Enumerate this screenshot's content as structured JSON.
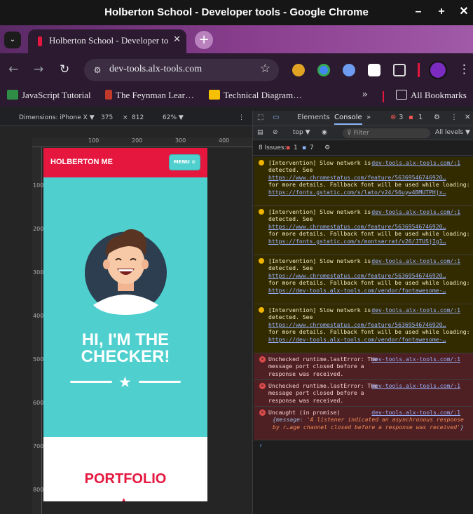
{
  "window": {
    "title": "Holberton School - Developer tools - Google Chrome",
    "controls": [
      "–",
      "+",
      "✕"
    ]
  },
  "tab": {
    "label": "Holberton School - Developer tools",
    "close": "✕",
    "new_tab": "+",
    "dropdown": "⌄"
  },
  "toolbar": {
    "back": "←",
    "forward": "→",
    "reload": "↻",
    "url": "dev-tools.alx-tools.com",
    "star": "☆",
    "menu": "⋮"
  },
  "extensions": [
    {
      "color": "#e0a324"
    },
    {
      "color": "#4285f4"
    },
    {
      "color": "#6d9cf0"
    },
    {
      "color": "#ffffff"
    },
    {
      "color": "#cccccc"
    },
    {
      "color": "#7b2bbf"
    }
  ],
  "bookmarks": [
    {
      "label": "JavaScript Tutorial",
      "color": "#2f8d46"
    },
    {
      "label": "The Feynman Lear…",
      "color": "#c0392b"
    },
    {
      "label": "Technical Diagram…",
      "color": "#f6c000"
    },
    {
      "label": "»",
      "color": "#00000000"
    },
    {
      "label": "All Bookmarks",
      "color": "#00000000"
    }
  ],
  "devbar": {
    "dimensions": "Dimensions: iPhone X ▼",
    "width": "375",
    "x": "×",
    "height": "812",
    "zoom": "62% ▼",
    "more": "⋮"
  },
  "ruler": {
    "h": [
      "100",
      "200",
      "300",
      "400"
    ],
    "v": [
      "100",
      "200",
      "300",
      "400",
      "500",
      "600",
      "700",
      "800"
    ]
  },
  "site": {
    "brand": "HOLBERTON ME",
    "menu": "MENU ≡",
    "hero_title": "HI, I'M THE CHECKER!",
    "section": "PORTFOLIO",
    "colors": {
      "accent": "#e5173f",
      "teal": "#4fd0cf"
    }
  },
  "devtools": {
    "tabs": {
      "elements": "Elements",
      "console": "Console",
      "more": "»",
      "errors": "3",
      "warnings": "1",
      "settings": "⚙",
      "menu": "⋮",
      "close": "✕"
    },
    "console_toolbar": {
      "context": "top ▼",
      "filter": "Filter",
      "levels": "All levels ▼"
    },
    "issues": {
      "label": "8 Issues:",
      "errors": "1",
      "info": "7",
      "settings": "⚙"
    },
    "messages": [
      {
        "type": "warn",
        "source": "dev-tools.alx-tools.com/:1",
        "text": "[Intervention] Slow network is detected. See",
        "link": "https://www.chromestatus.com/feature/56369546746920…",
        "text2": "for more details. Fallback font will be used while loading:",
        "link2": "https://fonts.gstatic.com/s/lato/v24/S6uyw4BMUTPHjx…"
      },
      {
        "type": "warn",
        "source": "dev-tools.alx-tools.com/:1",
        "text": "[Intervention] Slow network is detected. See",
        "link": "https://www.chromestatus.com/feature/56369546746920…",
        "text2": "for more details. Fallback font will be used while loading:",
        "link2": "https://fonts.gstatic.com/s/montserrat/v26/JTUSjIg1…"
      },
      {
        "type": "warn",
        "source": "dev-tools.alx-tools.com/:1",
        "text": "[Intervention] Slow network is detected. See",
        "link": "https://www.chromestatus.com/feature/56369546746920…",
        "text2": "for more details. Fallback font will be used while loading:",
        "link2": "https://dev-tools.alx-tools.com/vendor/fontawesome-…"
      },
      {
        "type": "warn",
        "source": "dev-tools.alx-tools.com/:1",
        "text": "[Intervention] Slow network is detected. See",
        "link": "https://www.chromestatus.com/feature/56369546746920…",
        "text2": "for more details. Fallback font will be used while loading:",
        "link2": "https://dev-tools.alx-tools.com/vendor/fontawesome-…"
      },
      {
        "type": "err",
        "source": "dev-tools.alx-tools.com/:1",
        "text": "Unchecked runtime.lastError: The message port closed before a response was received."
      },
      {
        "type": "err",
        "source": "dev-tools.alx-tools.com/:1",
        "text": "Unchecked runtime.lastError: The message port closed before a response was received."
      },
      {
        "type": "err",
        "source": "dev-tools.alx-tools.com/:1",
        "text": "Uncaught (in promise)",
        "obj_key": "{message: ",
        "obj_val": "'A listener indicated an asynchronous response by r…age channel closed before a response was received'",
        "obj_end": "}"
      }
    ],
    "prompt": "›"
  }
}
